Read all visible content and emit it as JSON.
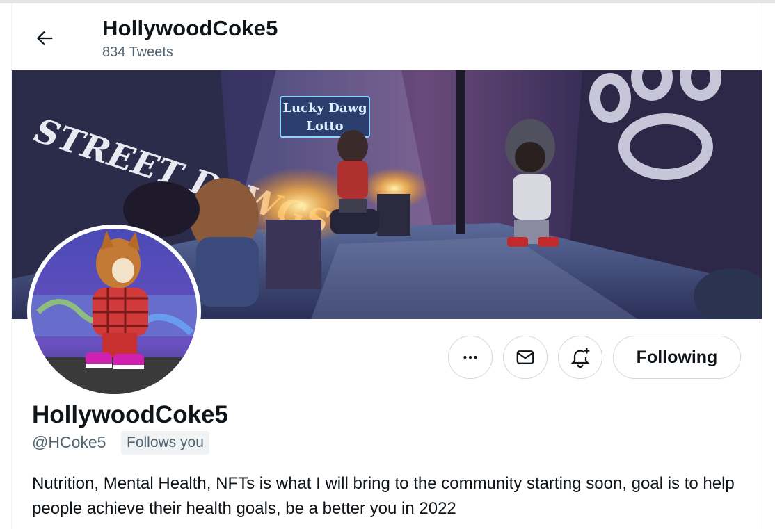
{
  "header": {
    "name": "HollywoodCoke5",
    "tweets_count": "834 Tweets"
  },
  "banner": {
    "graffiti_text": "STREET DAWGS",
    "sign_line1": "Lucky Dawg",
    "sign_line2": "Lotto"
  },
  "profile": {
    "name": "HollywoodCoke5",
    "handle": "@HCoke5",
    "follows_you": "Follows you",
    "bio": "Nutrition, Mental Health, NFTs is what I will bring to the community starting soon, goal is to help people achieve their health goals, be a better you in 2022"
  },
  "actions": {
    "following_label": "Following",
    "more_icon": "more-icon",
    "message_icon": "mail-icon",
    "notify_icon": "bell-plus-icon"
  },
  "colors": {
    "text_primary": "#0f1419",
    "text_secondary": "#536471",
    "border": "#cfd9de",
    "badge_bg": "#eff3f4"
  }
}
